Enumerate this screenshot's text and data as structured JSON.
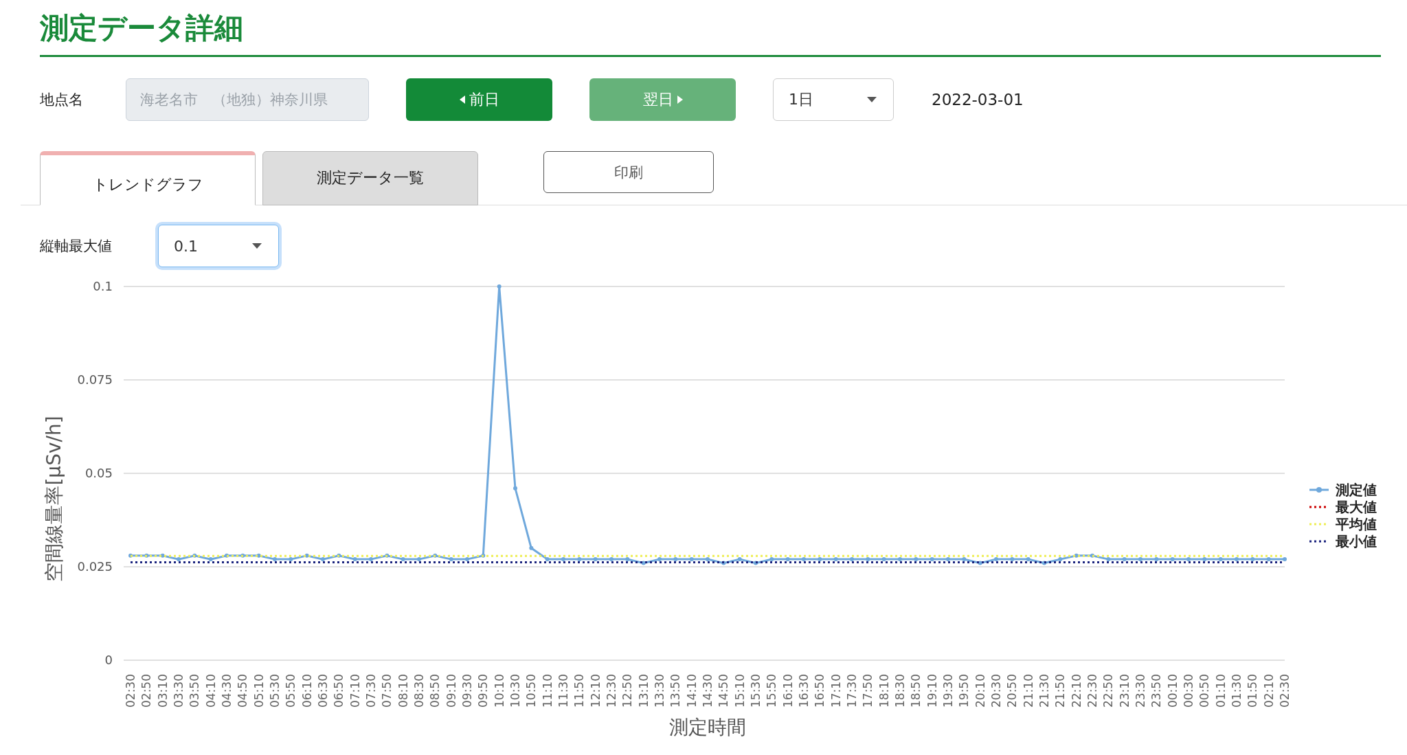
{
  "page_title": "測定データ詳細",
  "location": {
    "label": "地点名",
    "value": "海老名市　（地独）神奈川県",
    "disabled": true
  },
  "nav_buttons": [
    {
      "label": "前日",
      "kind": "prev",
      "disabled": false
    },
    {
      "label": "翌日",
      "kind": "next",
      "disabled": true
    }
  ],
  "period_select": {
    "value": "1日"
  },
  "date": "2022-03-01",
  "tabs": [
    {
      "label": "トレンドグラフ",
      "selected": true
    },
    {
      "label": "測定データ一覧",
      "selected": false
    }
  ],
  "print_button": "印刷",
  "y_max_select": {
    "label": "縦軸最大値",
    "value": "0.1",
    "focused": true
  },
  "chart_data": {
    "type": "line",
    "xlabel": "測定時間",
    "ylabel": "空間線量率[μSv/h]",
    "categories": [
      "02:30",
      "02:50",
      "03:10",
      "03:30",
      "03:50",
      "04:10",
      "04:30",
      "04:50",
      "05:10",
      "05:30",
      "05:50",
      "06:10",
      "06:30",
      "06:50",
      "07:10",
      "07:30",
      "07:50",
      "08:10",
      "08:30",
      "08:50",
      "09:10",
      "09:30",
      "09:50",
      "10:10",
      "10:30",
      "10:50",
      "11:10",
      "11:30",
      "11:50",
      "12:10",
      "12:30",
      "12:50",
      "13:10",
      "13:30",
      "13:50",
      "14:10",
      "14:30",
      "14:50",
      "15:10",
      "15:30",
      "15:50",
      "16:10",
      "16:30",
      "16:50",
      "17:10",
      "17:30",
      "17:50",
      "18:10",
      "18:30",
      "18:50",
      "19:10",
      "19:30",
      "19:50",
      "20:10",
      "20:30",
      "20:50",
      "21:10",
      "21:30",
      "21:50",
      "22:10",
      "22:30",
      "22:50",
      "23:10",
      "23:30",
      "23:50",
      "00:10",
      "00:30",
      "00:50",
      "01:10",
      "01:30",
      "01:50",
      "02:10",
      "02:30"
    ],
    "grid": true,
    "legend": true,
    "ylim": [
      0,
      0.1
    ],
    "yticks": [
      {
        "value": 0,
        "label": "0"
      },
      {
        "value": 0.025,
        "label": "0.025"
      },
      {
        "value": 0.05,
        "label": "0.05"
      },
      {
        "value": 0.075,
        "label": "0.075"
      },
      {
        "value": 0.1,
        "label": "0.1"
      }
    ],
    "series": [
      {
        "name": "測定値",
        "color": "#6fa8dc",
        "line_style": "solid",
        "marker": "circle",
        "values": [
          0.028,
          0.028,
          0.028,
          0.027,
          0.028,
          0.027,
          0.028,
          0.028,
          0.028,
          0.027,
          0.027,
          0.028,
          0.027,
          0.028,
          0.027,
          0.027,
          0.028,
          0.027,
          0.027,
          0.028,
          0.027,
          0.027,
          0.028,
          0.1,
          0.046,
          0.03,
          0.027,
          0.027,
          0.027,
          0.027,
          0.027,
          0.027,
          0.026,
          0.027,
          0.027,
          0.027,
          0.027,
          0.026,
          0.027,
          0.026,
          0.027,
          0.027,
          0.027,
          0.027,
          0.027,
          0.027,
          0.027,
          0.027,
          0.027,
          0.027,
          0.027,
          0.027,
          0.027,
          0.026,
          0.027,
          0.027,
          0.027,
          0.026,
          0.027,
          0.028,
          0.028,
          0.027,
          0.027,
          0.027,
          0.027,
          0.027,
          0.027,
          0.027,
          0.027,
          0.027,
          0.027,
          0.027,
          0.027
        ]
      },
      {
        "name": "最大値",
        "color": "#cc0000",
        "line_style": "dotted",
        "values": [
          null,
          null,
          null,
          null,
          null,
          null,
          null,
          null,
          null,
          null,
          null,
          null,
          null,
          null,
          null,
          null,
          null,
          null,
          null,
          null,
          null,
          null,
          null,
          null,
          null,
          null,
          null,
          null,
          null,
          null,
          null,
          null,
          null,
          null,
          null,
          null,
          null,
          null,
          null,
          null,
          null,
          null,
          null,
          null,
          null,
          null,
          null,
          null,
          null,
          null,
          null,
          null,
          null,
          null,
          null,
          null,
          null,
          null,
          null,
          null,
          null,
          null,
          null,
          null,
          null,
          null,
          null,
          null,
          null,
          null,
          null,
          null,
          null
        ]
      },
      {
        "name": "平均値",
        "color": "#eeee55",
        "line_style": "dotted",
        "values": [
          0.0279,
          0.0279,
          0.0279,
          0.0279,
          0.0279,
          0.0279,
          0.0279,
          0.0279,
          0.0279,
          0.0279,
          0.0279,
          0.0279,
          0.0279,
          0.0279,
          0.0279,
          0.0279,
          0.0279,
          0.0279,
          0.0279,
          0.0279,
          0.0279,
          0.0279,
          0.0279,
          0.0279,
          0.0279,
          0.0279,
          0.0279,
          0.0279,
          0.0279,
          0.0279,
          0.0279,
          0.0279,
          0.0279,
          0.0279,
          0.0279,
          0.0279,
          0.0279,
          0.0279,
          0.0279,
          0.0279,
          0.0279,
          0.0279,
          0.0279,
          0.0279,
          0.0279,
          0.0279,
          0.0279,
          0.0279,
          0.0279,
          0.0279,
          0.0279,
          0.0279,
          0.0279,
          0.0279,
          0.0279,
          0.0279,
          0.0279,
          0.0279,
          0.0279,
          0.0279,
          0.0279,
          0.0279,
          0.0279,
          0.0279,
          0.0279,
          0.0279,
          0.0279,
          0.0279,
          0.0279,
          0.0279,
          0.0279,
          0.0279,
          0.0279
        ]
      },
      {
        "name": "最小値",
        "color": "#1a237e",
        "line_style": "dotted",
        "values": [
          0.0262,
          0.0262,
          0.0262,
          0.0262,
          0.0262,
          0.0262,
          0.0262,
          0.0262,
          0.0262,
          0.0262,
          0.0262,
          0.0262,
          0.0262,
          0.0262,
          0.0262,
          0.0262,
          0.0262,
          0.0262,
          0.0262,
          0.0262,
          0.0262,
          0.0262,
          0.0262,
          0.0262,
          0.0262,
          0.0262,
          0.0262,
          0.0262,
          0.0262,
          0.0262,
          0.0262,
          0.0262,
          0.0262,
          0.0262,
          0.0262,
          0.0262,
          0.0262,
          0.0262,
          0.0262,
          0.0262,
          0.0262,
          0.0262,
          0.0262,
          0.0262,
          0.0262,
          0.0262,
          0.0262,
          0.0262,
          0.0262,
          0.0262,
          0.0262,
          0.0262,
          0.0262,
          0.0262,
          0.0262,
          0.0262,
          0.0262,
          0.0262,
          0.0262,
          0.0262,
          0.0262,
          0.0262,
          0.0262,
          0.0262,
          0.0262,
          0.0262,
          0.0262,
          0.0262,
          0.0262,
          0.0262,
          0.0262,
          0.0262,
          0.0262
        ]
      }
    ]
  }
}
